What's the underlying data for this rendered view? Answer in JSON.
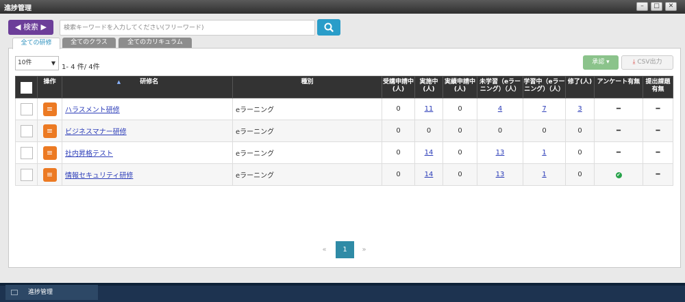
{
  "window": {
    "title": "進捗管理",
    "min_glyph": "–",
    "max_glyph": "□",
    "close_glyph": "✕"
  },
  "search": {
    "button_label": "◀ 検索 ▶",
    "placeholder": "検索キーワードを入力してください(フリーワード)",
    "search_icon": "magnifier-icon"
  },
  "tabs": [
    "全ての研修",
    "全てのクラス",
    "全てのカリキュラム"
  ],
  "page_size": {
    "selected": "10件",
    "caret": "▼"
  },
  "count_text": "1- 4 件/ 4件",
  "toolbar": {
    "approve_label": "承認 ▾",
    "csv_label": "CSV出力",
    "csv_icon": "⤓"
  },
  "table": {
    "headers": {
      "operation": "操作",
      "name": "研修名",
      "type": "種別",
      "applying": "受講申請中(人)",
      "in_progress": "実施中(人)",
      "completion_applying": "実績申請中(人)",
      "not_started": "未学習（eラーニング）（人）",
      "learning": "学習中（eラーニング）（人）",
      "completed": "修了(人)",
      "survey": "アンケート有無",
      "submission": "提出課題有無"
    },
    "sort_indicator": "▲",
    "operation_glyph": "≡",
    "rows": [
      {
        "name": "ハラスメント研修",
        "type": "eラーニング",
        "applying": "0",
        "in_progress": "11",
        "completion_applying": "0",
        "not_started": "4",
        "learning": "7",
        "completed": "3",
        "survey": "━",
        "submission": "━"
      },
      {
        "name": "ビジネスマナー研修",
        "type": "eラーニング",
        "applying": "0",
        "in_progress": "0",
        "completion_applying": "0",
        "not_started": "0",
        "learning": "0",
        "completed": "0",
        "survey": "━",
        "submission": "━"
      },
      {
        "name": "社内昇格テスト",
        "type": "eラーニング",
        "applying": "0",
        "in_progress": "14",
        "completion_applying": "0",
        "not_started": "13",
        "learning": "1",
        "completed": "0",
        "survey": "━",
        "submission": "━"
      },
      {
        "name": "情報セキュリティ研修",
        "type": "eラーニング",
        "applying": "0",
        "in_progress": "14",
        "completion_applying": "0",
        "not_started": "13",
        "learning": "1",
        "completed": "0",
        "survey": "✔",
        "submission": "━"
      }
    ],
    "link_columns": [
      "in_progress",
      "not_started",
      "learning",
      "completed"
    ]
  },
  "pagination": {
    "prev": "«",
    "current": "1",
    "next": "»"
  },
  "taskbar": {
    "item_label": "進捗管理"
  },
  "colors": {
    "accent_purple": "#6c3e99",
    "search_blue": "#2a9dc9",
    "operation_orange": "#ec7a23",
    "approve_green": "#8bc38b",
    "pager_active": "#2f8ba6"
  }
}
